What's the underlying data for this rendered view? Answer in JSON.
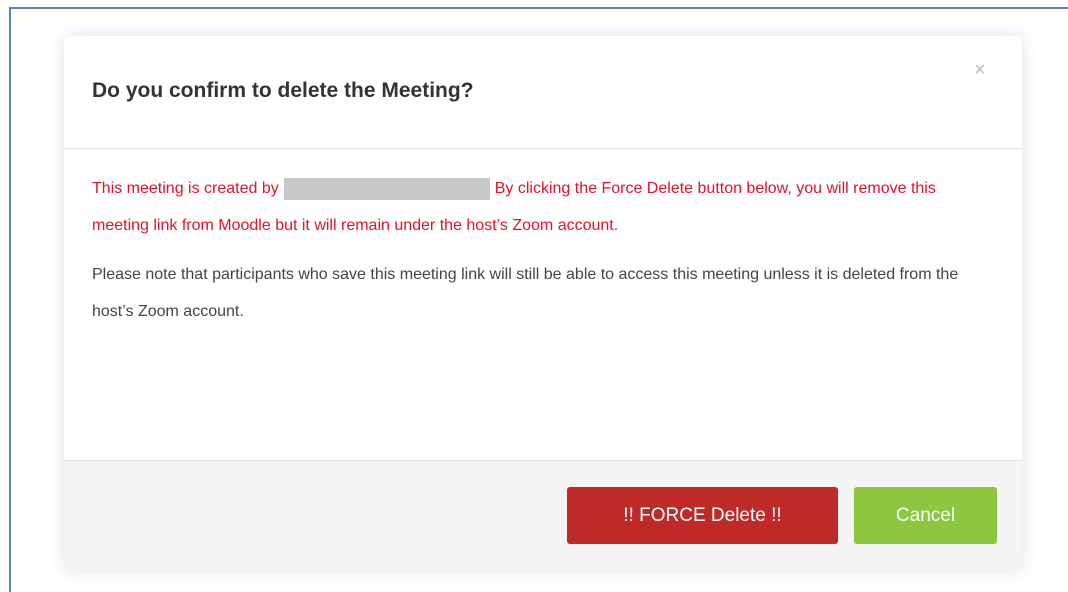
{
  "modal": {
    "title": "Do you confirm to delete the Meeting?",
    "close_symbol": "×",
    "warning_before": "This meeting is created by",
    "warning_after": "By clicking the Force Delete button below, you will remove this meeting link from Moodle but it will remain under the host’s Zoom account.",
    "note": "Please note that participants who save this meeting link will still be able to access this meeting unless it is deleted from the host’s Zoom account.",
    "force_delete_label": "!! FORCE Delete !!",
    "cancel_label": "Cancel"
  },
  "colors": {
    "warning_text": "#e0132b",
    "danger_button": "#bf2a26",
    "cancel_button": "#8dc63f"
  }
}
